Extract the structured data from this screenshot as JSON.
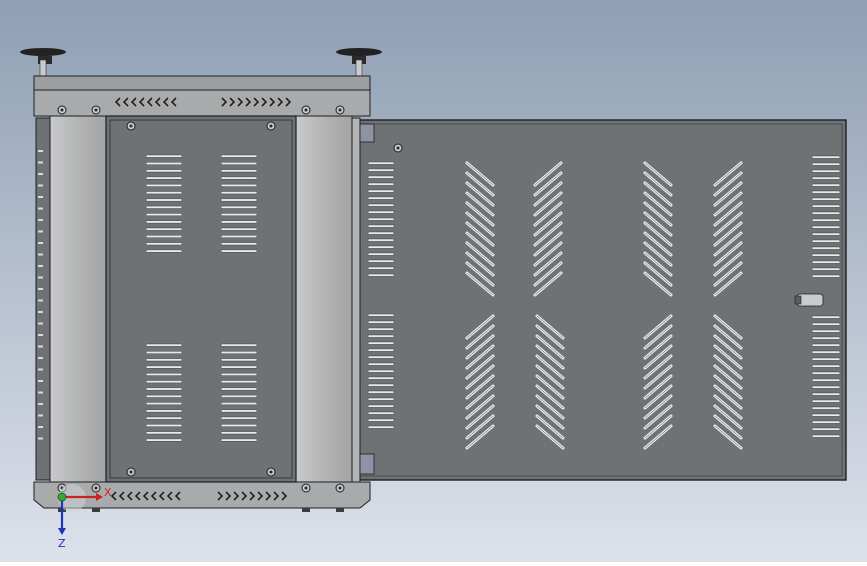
{
  "view": {
    "background_top": "#8f9fb4",
    "background_bottom": "#dde1ea",
    "body_color": "#6e7275",
    "rail_color": "#b8b9ba",
    "frame_color": "#a9aaab",
    "edge_color": "#1c1f22",
    "slot_color": "#e8eaec",
    "knob_color": "#2a2a2a"
  },
  "triad": {
    "x_label": "X",
    "z_label": "Z",
    "x_color": "#cc2222",
    "z_color": "#2233bb",
    "origin_color": "#33aa33"
  },
  "parts": {
    "frame": "frame-assembly",
    "side_panel": "side-panel",
    "drawer_panel": "drawer-panel",
    "knobs": [
      "left-knob",
      "right-knob"
    ]
  }
}
